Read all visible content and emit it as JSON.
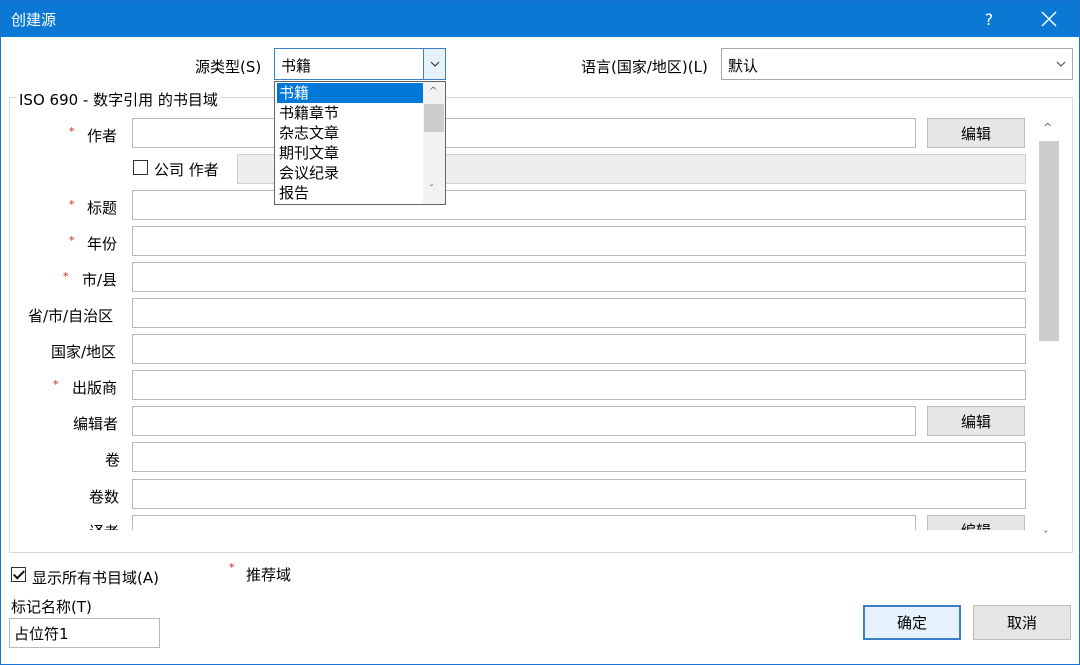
{
  "dialog": {
    "title": "创建源",
    "help_glyph": "?",
    "close_icon": "close-icon"
  },
  "source_type": {
    "label": "源类型(S)",
    "value": "书籍",
    "options": [
      "书籍",
      "书籍章节",
      "杂志文章",
      "期刊文章",
      "会议纪录",
      "报告"
    ]
  },
  "language": {
    "label": "语言(国家/地区)(L)",
    "value": "默认"
  },
  "group": {
    "title": "ISO 690 - 数字引用 的书目域"
  },
  "fields": {
    "author": "作者",
    "corporate_author": "公司 作者",
    "title": "标题",
    "year": "年份",
    "city": "市/县",
    "state": "省/市/自治区",
    "country": "国家/地区",
    "publisher": "出版商",
    "editor": "编辑者",
    "volume": "卷",
    "num_volumes": "卷数",
    "translator": "译者"
  },
  "required_mark": "*",
  "edit_label": "编辑",
  "show_all_label": "显示所有书目域(A)",
  "recommended_legend": "推荐域",
  "tag_name": {
    "label": "标记名称(T)",
    "value": "占位符1"
  },
  "ok_label": "确定",
  "cancel_label": "取消",
  "colors": {
    "titlebar": "#0b78d4",
    "selection": "#0078d7",
    "required": "#e0231b"
  }
}
